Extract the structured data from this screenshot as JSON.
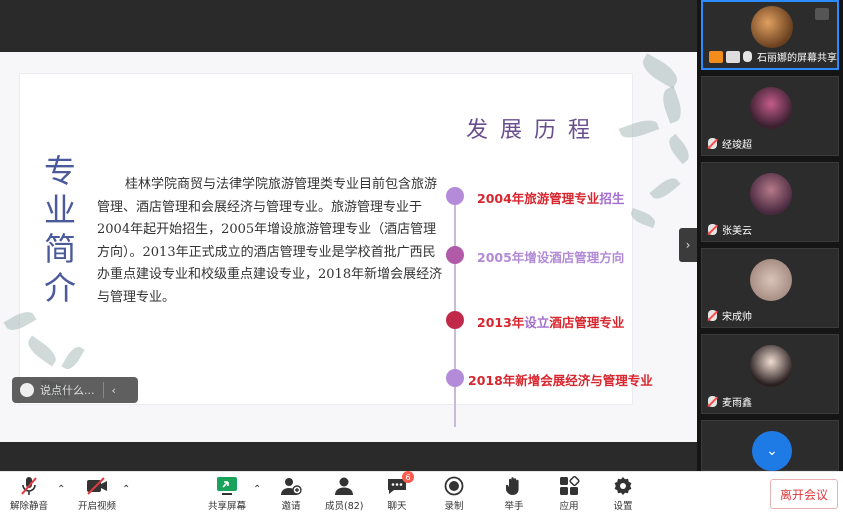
{
  "slide": {
    "vertical_title": "专业简介",
    "heading": "发展历程",
    "paragraph": "桂林学院商贸与法律学院旅游管理类专业目前包含旅游管理、酒店管理和会展经济与管理专业。旅游管理专业于2004年起开始招生，2005年增设旅游管理专业（酒店管理方向）。2013年正式成立的酒店管理专业是学校首批广西民办重点建设专业和校级重点建设专业，2018年新增会展经济与管理专业。",
    "timeline": [
      {
        "p1": "2004年",
        "p2": "旅游管理专业",
        "p3": "招生",
        "dot_color": "#b48bd9"
      },
      {
        "p1": "2005年增设酒店管理方向",
        "p2": "",
        "p3": "",
        "dot_color": "#b05aa8"
      },
      {
        "p1": "2013年",
        "p2": "设立",
        "p3": "酒店管理专业",
        "dot_color": "#c0294a"
      },
      {
        "p1": "2018年新增",
        "p2": "会展经济与管理专业",
        "p3": "",
        "dot_color": "#b48bd9"
      }
    ]
  },
  "chat_input": {
    "placeholder": "说点什么..."
  },
  "participants": [
    {
      "name": "石丽娜的屏幕共享",
      "active": true
    },
    {
      "name": "经竣超",
      "active": false
    },
    {
      "name": "张美云",
      "active": false
    },
    {
      "name": "宋成帅",
      "active": false
    },
    {
      "name": "麦雨鑫",
      "active": false
    }
  ],
  "toolbar": {
    "unmute": "解除静音",
    "start_video": "开启视频",
    "share_screen": "共享屏幕",
    "invite": "邀请",
    "members": "成员(82)",
    "chat": "聊天",
    "chat_badge": "6",
    "record": "录制",
    "raise_hand": "举手",
    "apps": "应用",
    "settings": "设置",
    "leave": "离开会议"
  },
  "colors": {
    "accent": "#2b8cff",
    "danger": "#e0393e",
    "share_green": "#1aa35b"
  }
}
